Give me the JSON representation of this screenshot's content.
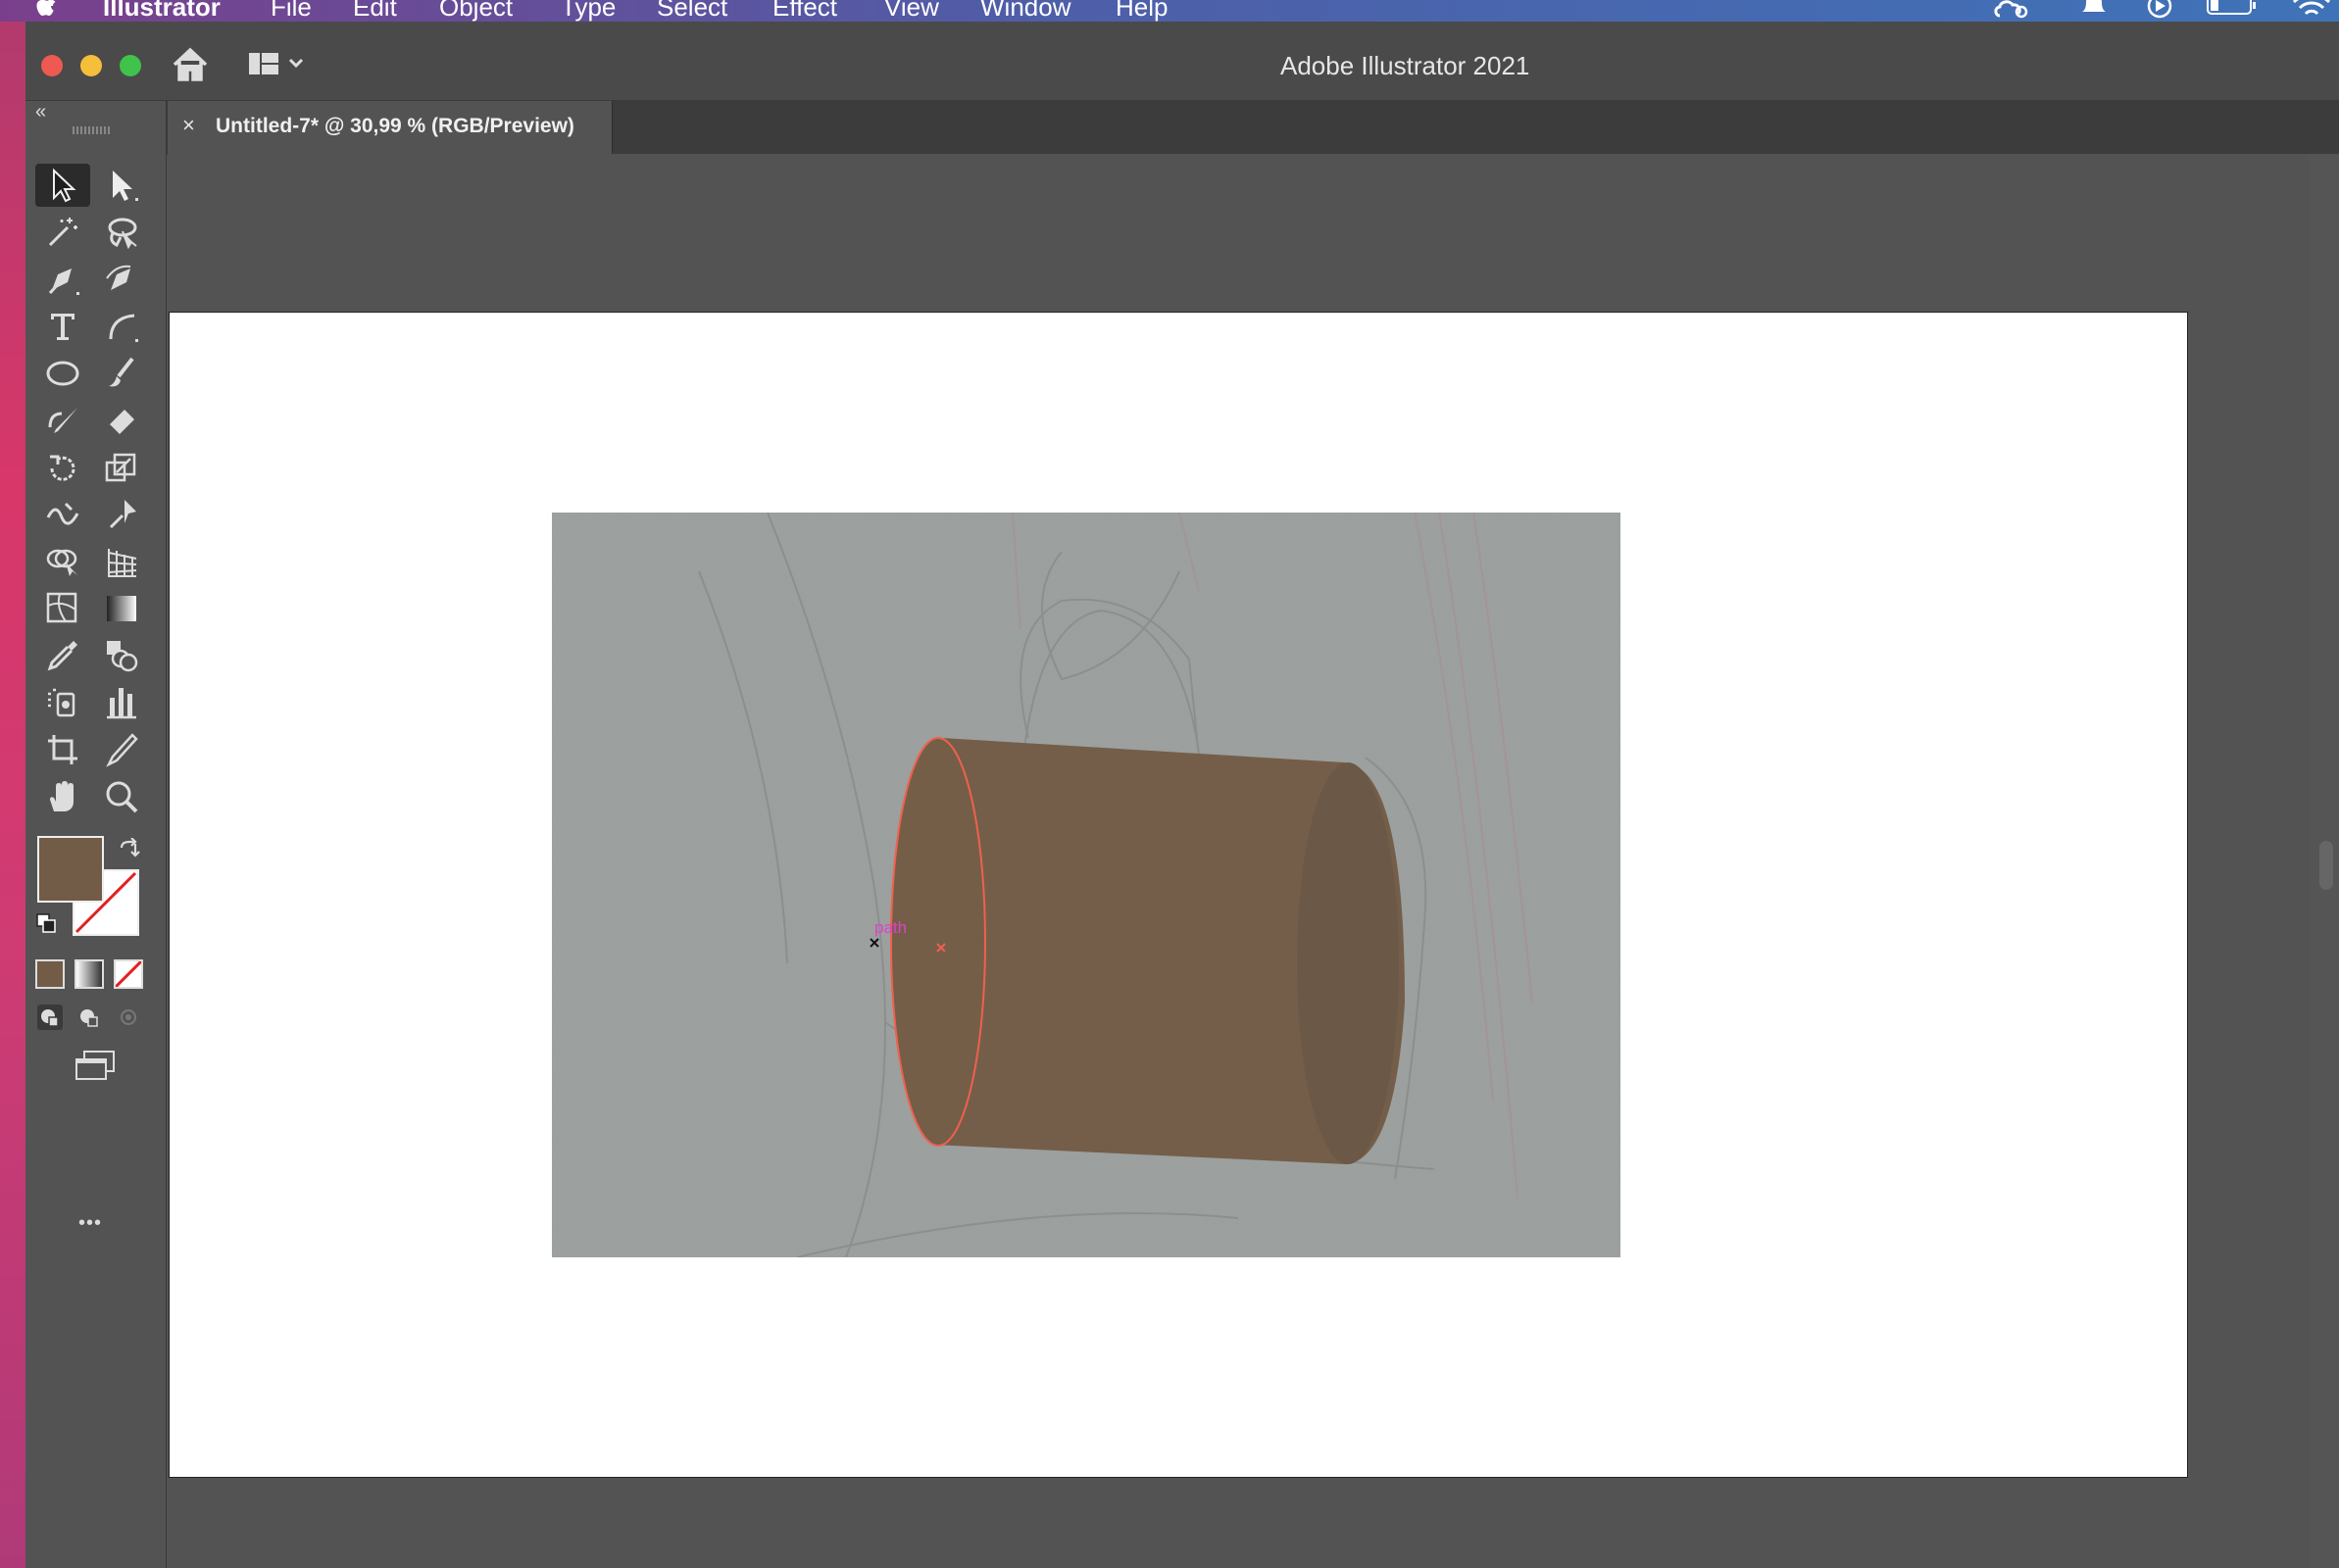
{
  "menubar": {
    "app_name": "Illustrator",
    "items": [
      "File",
      "Edit",
      "Object",
      "Type",
      "Select",
      "Effect",
      "View",
      "Window",
      "Help"
    ]
  },
  "window": {
    "title": "Adobe Illustrator 2021"
  },
  "document_tab": {
    "close_symbol": "×",
    "label": "Untitled-7* @ 30,99 % (RGB/Preview)"
  },
  "canvas": {
    "hover_label": "path"
  },
  "toolbar": {
    "collapse": "«",
    "more": "•••",
    "fill_color": "#725c47",
    "tools": [
      "selection-tool",
      "direct-selection-tool",
      "magic-wand-tool",
      "lasso-tool",
      "pen-tool",
      "curvature-tool",
      "type-tool",
      "arc-tool",
      "ellipse-tool",
      "paintbrush-tool",
      "pencil-tool",
      "eraser-tool",
      "rotate-tool",
      "scale-tool",
      "warp-tool",
      "puppet-warp-tool",
      "free-transform-tool",
      "perspective-grid-tool",
      "mesh-tool",
      "gradient-tool",
      "eyedropper-tool",
      "blend-tool",
      "symbol-sprayer-tool",
      "column-graph-tool",
      "artboard-tool",
      "slice-tool",
      "hand-tool",
      "zoom-tool"
    ]
  },
  "colors": {
    "ui_dark": "#535353",
    "tab_bar": "#3c3c3c",
    "selection_outline": "#f0604d",
    "path_label": "#e040c8"
  }
}
